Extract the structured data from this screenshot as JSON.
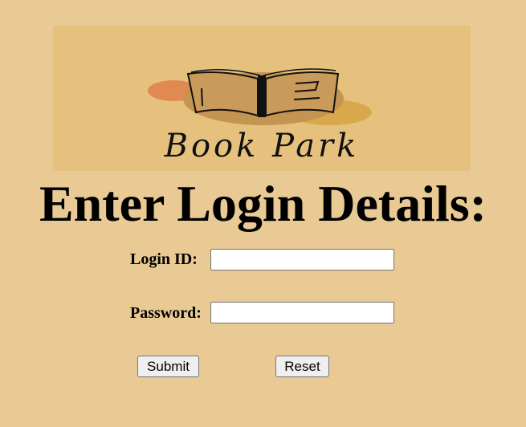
{
  "logo": {
    "text": "Book Park",
    "background_color": "#e6c17e",
    "icon": "open-book-icon"
  },
  "heading": "Enter Login Details:",
  "form": {
    "login_label": "Login ID:",
    "login_value": "",
    "password_label": "Password:",
    "password_value": "",
    "submit_label": "Submit",
    "reset_label": "Reset"
  },
  "colors": {
    "page_background": "#e9c994",
    "blob_orange": "#e08a52",
    "blob_brown": "#c49552",
    "blob_gold": "#d9a84a"
  }
}
